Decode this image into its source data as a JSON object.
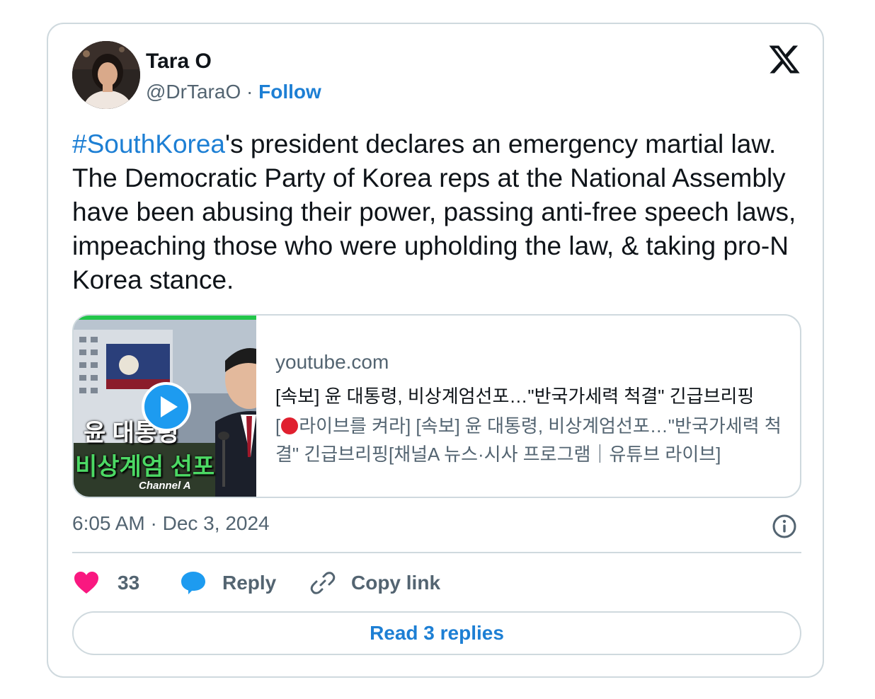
{
  "author": {
    "name": "Tara O",
    "handle": "@DrTaraO",
    "separator": "·",
    "follow_label": "Follow",
    "avatar_icon": "avatar-photo"
  },
  "brand_icon": "x-logo-icon",
  "tweet": {
    "hashtag": "#SouthKorea",
    "text": "'s president declares an emergency martial law. The Democratic Party of Korea reps at the National Assembly have been abusing their power, passing anti-free speech laws, impeaching those who were upholding the law, & taking pro-N Korea stance."
  },
  "link_card": {
    "domain": "youtube.com",
    "title": "[속보] 윤 대통령, 비상계엄선포…\"반국가세력 척결\" 긴급브리핑",
    "description_prefix": "[",
    "description": "라이브를 켜라] [속보] 윤 대통령, 비상계엄선포…\"반국가세력 척결\" 긴급브리핑[채널A 뉴스·시사 프로그램｜유튜브 라이브]",
    "thumbnail": {
      "overlay_line1": "윤 대통령",
      "overlay_line2": "비상계엄 선포",
      "channel_logo": "Channel A"
    }
  },
  "meta": {
    "timestamp": "6:05 AM · Dec 3, 2024"
  },
  "actions": {
    "like_count": "33",
    "reply_label": "Reply",
    "copy_link_label": "Copy link",
    "read_replies_label": "Read 3 replies"
  },
  "colors": {
    "link_blue": "#1d7fd4",
    "heart_pink": "#f91880",
    "reply_blue": "#1d9bf0",
    "secondary_text": "#536471",
    "border": "#cfd9de",
    "thumb_green": "#22c64a"
  }
}
